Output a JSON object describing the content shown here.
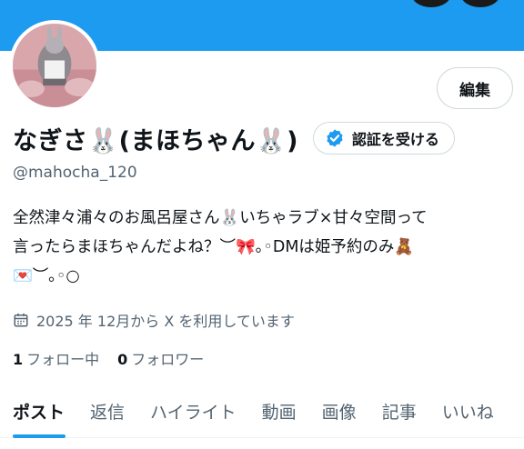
{
  "profile": {
    "display_name": "なぎさ🐰(まほちゃん🐰)",
    "handle": "@mahocha_120",
    "edit_label": "編集",
    "verify_label": "認証を受ける",
    "bio_lines": [
      "全然津々浦々のお風呂屋さん🐰いちゃラブ×甘々空間って",
      "言ったらまほちゃんだよね？︶🎀｡◦DMは姫予約のみ🧸",
      "💌︶｡◦○"
    ],
    "joined": "2025 年 12月から X を利用しています",
    "following_count": "1",
    "following_label": "フォロー中",
    "followers_count": "0",
    "followers_label": "フォロワー"
  },
  "tabs": [
    {
      "label": "ポスト",
      "active": true
    },
    {
      "label": "返信",
      "active": false
    },
    {
      "label": "ハイライト",
      "active": false
    },
    {
      "label": "動画",
      "active": false
    },
    {
      "label": "画像",
      "active": false
    },
    {
      "label": "記事",
      "active": false
    },
    {
      "label": "いいね",
      "active": false
    }
  ],
  "colors": {
    "accent": "#1d9bf0",
    "text": "#0f1419",
    "muted": "#536471"
  },
  "icons": {
    "verify": "verified-badge-icon",
    "joined": "calendar-icon"
  }
}
